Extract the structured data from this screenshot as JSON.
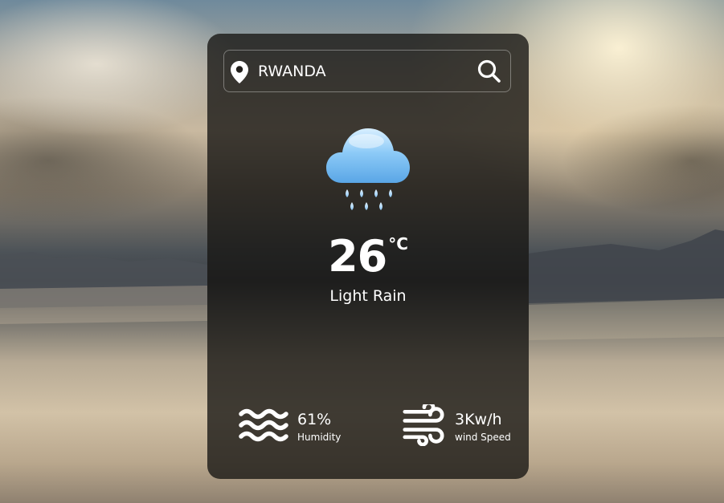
{
  "search": {
    "value": "RWANDA",
    "icon": "location-pin-icon",
    "button_icon": "search-icon"
  },
  "weather": {
    "icon": "rain-cloud-icon",
    "temperature": "26",
    "unit": "°C",
    "description": "Light Rain"
  },
  "details": {
    "humidity": {
      "icon": "waves-icon",
      "value": "61%",
      "label": "Humidity"
    },
    "wind": {
      "icon": "wind-icon",
      "value": "3Kw/h",
      "label": "wind Speed"
    }
  },
  "colors": {
    "card_background": "#161412",
    "text": "#ffffff",
    "cloud": "#7fc0f2",
    "rain_drop": "#a9d7fb"
  }
}
